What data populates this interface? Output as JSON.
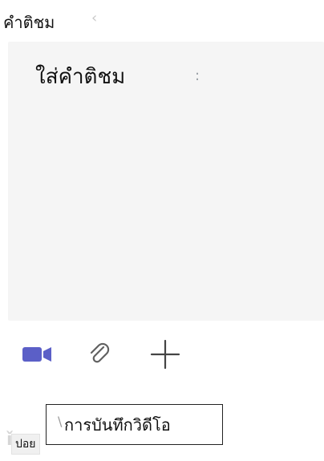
{
  "section": {
    "label": "คำติชม"
  },
  "comment": {
    "placeholder": "ใส่คำติชม"
  },
  "toolbar": {
    "video_icon": "video-camera-icon",
    "attach_icon": "paperclip-icon",
    "add_icon": "plus-icon",
    "accent_color": "#5b5fc7",
    "icon_color": "#616161"
  },
  "tooltip": {
    "text": "การบันทึกวิดีโอ"
  },
  "bottom": {
    "chip_text": "ปอย"
  }
}
